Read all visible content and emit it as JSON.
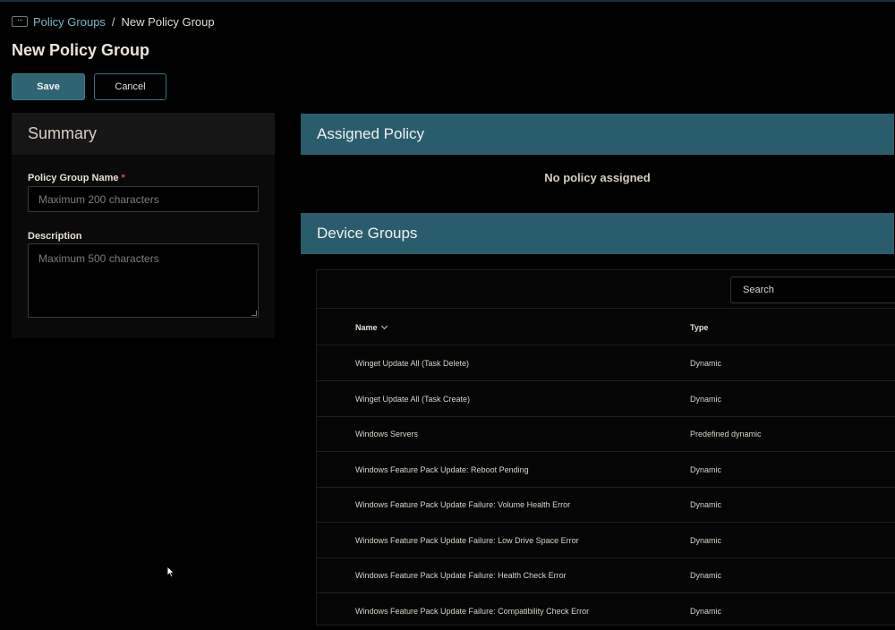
{
  "breadcrumb": {
    "toggle_glyph": "···",
    "parent": "Policy Groups",
    "separator": "/",
    "current": "New Policy Group"
  },
  "page_title": "New Policy Group",
  "actions": {
    "save_label": "Save",
    "cancel_label": "Cancel"
  },
  "summary": {
    "title": "Summary",
    "name_label": "Policy Group Name",
    "required_mark": "*",
    "name_placeholder": "Maximum 200 characters",
    "name_value": "",
    "description_label": "Description",
    "description_placeholder": "Maximum 500 characters",
    "description_value": ""
  },
  "assigned_policy": {
    "title": "Assigned Policy",
    "empty_text": "No policy assigned"
  },
  "device_groups": {
    "title": "Device Groups",
    "search_placeholder": "Search",
    "columns": {
      "name": "Name",
      "type": "Type"
    },
    "rows": [
      {
        "name": "Winget Update All (Task Delete)",
        "type": "Dynamic"
      },
      {
        "name": "Winget Update All (Task Create)",
        "type": "Dynamic"
      },
      {
        "name": "Windows Servers",
        "type": "Predefined dynamic"
      },
      {
        "name": "Windows Feature Pack Update: Reboot Pending",
        "type": "Dynamic"
      },
      {
        "name": "Windows Feature Pack Update Failure: Volume Health Error",
        "type": "Dynamic"
      },
      {
        "name": "Windows Feature Pack Update Failure: Low Drive Space Error",
        "type": "Dynamic"
      },
      {
        "name": "Windows Feature Pack Update Failure: Health Check Error",
        "type": "Dynamic"
      },
      {
        "name": "Windows Feature Pack Update Failure: Compatibility Check Error",
        "type": "Dynamic"
      }
    ]
  },
  "colors": {
    "accent": "#2a5d6b",
    "link": "#7fb6c4",
    "required": "#e04848",
    "background": "#000000"
  }
}
